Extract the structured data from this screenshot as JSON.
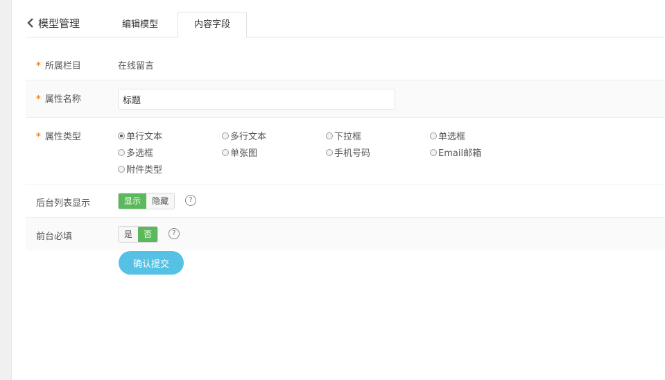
{
  "header": {
    "back_title": "模型管理",
    "tabs": [
      {
        "label": "编辑模型",
        "active": false
      },
      {
        "label": "内容字段",
        "active": true
      }
    ]
  },
  "form": {
    "category": {
      "label": "所属栏目",
      "required_mark": "*",
      "value": "在线留言"
    },
    "attr_name": {
      "label": "属性名称",
      "required_mark": "*",
      "value": "标题"
    },
    "attr_type": {
      "label": "属性类型",
      "required_mark": "*",
      "options": [
        "单行文本",
        "多行文本",
        "下拉框",
        "单选框",
        "多选框",
        "单张图",
        "手机号码",
        "Email邮箱",
        "附件类型"
      ],
      "selected": "单行文本"
    },
    "list_display": {
      "label": "后台列表显示",
      "options": [
        "显示",
        "隐藏"
      ],
      "selected": "显示",
      "help": "?"
    },
    "front_required": {
      "label": "前台必填",
      "options": [
        "是",
        "否"
      ],
      "selected": "否",
      "help": "?"
    },
    "submit_label": "确认提交"
  },
  "colors": {
    "accent_green": "#5cb85c",
    "submit_blue": "#55c1e5",
    "required_orange": "#f08a24"
  }
}
